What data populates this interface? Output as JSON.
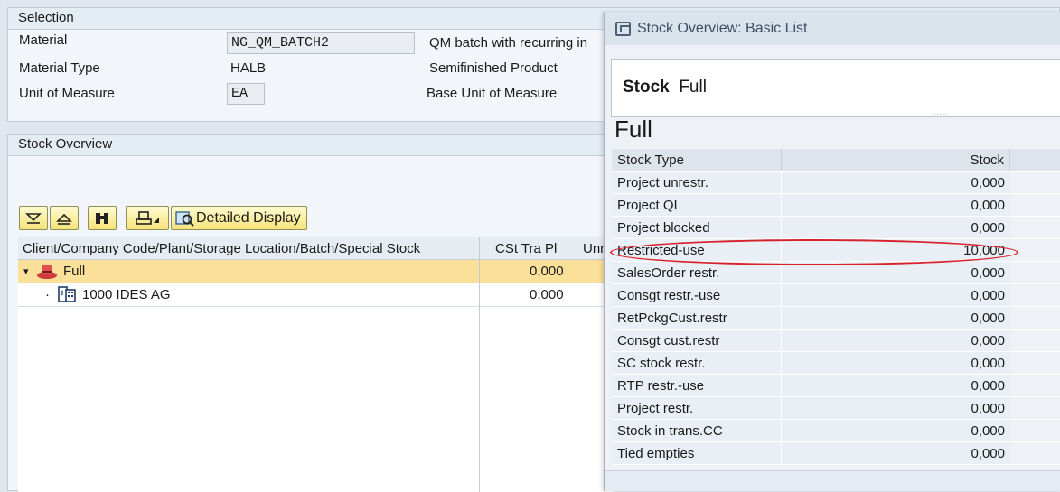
{
  "selection": {
    "title": "Selection",
    "material_label": "Material",
    "material_value": "NG_QM_BATCH2",
    "material_desc": "QM batch with recurring in",
    "material_type_label": "Material Type",
    "material_type_value": "HALB",
    "material_type_desc": "Semifinished Product",
    "uom_label": "Unit of Measure",
    "uom_value": "EA",
    "uom_desc": "Base Unit of Measure"
  },
  "stock_overview": {
    "title": "Stock Overview",
    "toolbar": {
      "expand_icon": "expand-all-icon",
      "collapse_icon": "collapse-all-icon",
      "find_icon": "binoculars-icon",
      "print_icon": "printer-icon",
      "detail_label": "Detailed Display"
    },
    "columns": [
      "Client/Company Code/Plant/Storage Location/Batch/Special Stock",
      "CSt Tra Pl",
      "Unr"
    ],
    "rows": [
      {
        "label": "Full",
        "value": "0,000"
      },
      {
        "label": "1000 IDES AG",
        "value": "0,000"
      }
    ]
  },
  "popup": {
    "title": "Stock Overview: Basic List",
    "header_bold": "Stock",
    "header_value": "Full",
    "subtitle": "Full",
    "dots": ".....",
    "columns": [
      "Stock Type",
      "Stock"
    ],
    "rows": [
      {
        "type": "Project unrestr.",
        "stock": "0,000"
      },
      {
        "type": "Project QI",
        "stock": "0,000"
      },
      {
        "type": "Project blocked",
        "stock": "0,000"
      },
      {
        "type": "Restricted-use",
        "stock": "10,000"
      },
      {
        "type": "SalesOrder restr.",
        "stock": "0,000"
      },
      {
        "type": "Consgt restr.-use",
        "stock": "0,000"
      },
      {
        "type": "RetPckgCust.restr",
        "stock": "0,000"
      },
      {
        "type": "Consgt cust.restr",
        "stock": "0,000"
      },
      {
        "type": "SC stock restr.",
        "stock": "0,000"
      },
      {
        "type": "RTP restr.-use",
        "stock": "0,000"
      },
      {
        "type": "Project restr.",
        "stock": "0,000"
      },
      {
        "type": "Stock in trans.CC",
        "stock": "0,000"
      },
      {
        "type": "Tied empties",
        "stock": "0,000"
      }
    ],
    "highlight_color": "#d7212a"
  }
}
